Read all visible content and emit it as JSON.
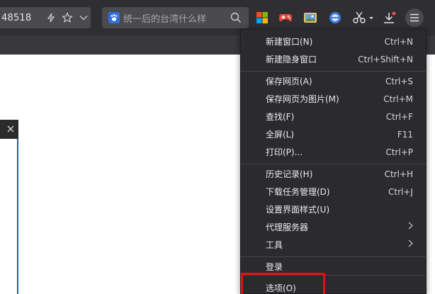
{
  "toolbar": {
    "url_fragment": "48518",
    "search_placeholder": "统一后的台湾什么样"
  },
  "main_menu": {
    "items": [
      {
        "label": "新建窗口(N)",
        "shortcut": "Ctrl+N"
      },
      {
        "label": "新建隐身窗口",
        "shortcut": "Ctrl+Shift+N"
      },
      {
        "label": "保存网页(A)",
        "shortcut": "Ctrl+S"
      },
      {
        "label": "保存网页为图片(M)",
        "shortcut": "Ctrl+M"
      },
      {
        "label": "查找(F)",
        "shortcut": "Ctrl+F"
      },
      {
        "label": "全屏(L)",
        "shortcut": "F11"
      },
      {
        "label": "打印(P)...",
        "shortcut": "Ctrl+P"
      },
      {
        "label": "历史记录(H)",
        "shortcut": "Ctrl+H"
      },
      {
        "label": "下载任务管理(D)",
        "shortcut": "Ctrl+J"
      },
      {
        "label": "设置界面样式(U)",
        "shortcut": ""
      },
      {
        "label": "代理服务器",
        "shortcut": ""
      },
      {
        "label": "工具",
        "shortcut": ""
      },
      {
        "label": "登录",
        "shortcut": ""
      },
      {
        "label": "选项(O)",
        "shortcut": ""
      }
    ]
  },
  "colors": {
    "toolbar_bg": "#2f2f33",
    "menu_bg": "#2b2b2f",
    "highlight": "#e50e13"
  }
}
